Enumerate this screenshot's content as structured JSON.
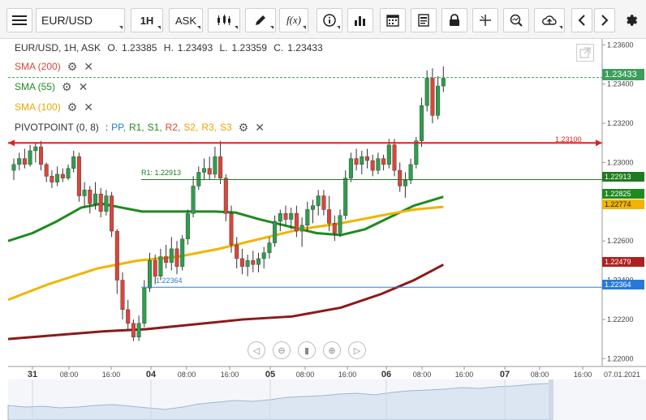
{
  "toolbar": {
    "symbol": "EUR/USD",
    "timeframe": "1H",
    "price_type": "ASK",
    "draw_icon": "pencil-icon",
    "function_label": "f(x)"
  },
  "legend": {
    "symbol": "EUR/USD, 1H, ASK",
    "open_label": "O.",
    "open": "1.23385",
    "high_label": "H.",
    "high": "1.23493",
    "low_label": "L.",
    "low": "1.23359",
    "close_label": "C.",
    "close": "1.23433",
    "sma200": "SMA (200)",
    "sma55": "SMA (55)",
    "sma100": "SMA (100)",
    "pivot": "PIVOTPOINT (0, 8)",
    "pivot_items": [
      "PP,",
      "R1,",
      "S1,",
      "R2,",
      "S2,",
      "R3,",
      "S3"
    ],
    "pivot_sep": ":"
  },
  "colors": {
    "sma200": "#8b1a1a",
    "sma55": "#1f8a1f",
    "sma100": "#f2b400",
    "up": "#2e9e4d",
    "down": "#d9463a",
    "pp": "#2a7ad5",
    "r1": "#1f8a1f",
    "s1": "#1f8a1f",
    "r2": "#d9463a",
    "s2": "#f2a000",
    "r3": "#f2a000",
    "s3": "#f2a000",
    "hline": "#e02020",
    "current": "#3a9e5a"
  },
  "price_axis": {
    "ticks": [
      "1.23600",
      "1.23400",
      "1.23200",
      "1.23000",
      "1.22600",
      "1.22400",
      "1.22200",
      "1.22000"
    ]
  },
  "price_labels": {
    "current": "1.23433",
    "hline": "1.23100",
    "r1": "1.22913",
    "sma55": "1.22825",
    "sma100": "1.22774",
    "sma200": "1.22479",
    "pp": "1.22364"
  },
  "chart_labels": {
    "r1": "R1: 1.22913",
    "pp": "1.22364",
    "hline": "1.23100"
  },
  "time_axis": {
    "ticks": [
      {
        "label": "31",
        "day": true
      },
      {
        "label": "08:00",
        "day": false
      },
      {
        "label": "16:00",
        "day": false
      },
      {
        "label": "04",
        "day": true
      },
      {
        "label": "08:00",
        "day": false
      },
      {
        "label": "16:00",
        "day": false
      },
      {
        "label": "05",
        "day": true
      },
      {
        "label": "08:00",
        "day": false
      },
      {
        "label": "16:00",
        "day": false
      },
      {
        "label": "06",
        "day": true
      },
      {
        "label": "08:00",
        "day": false
      },
      {
        "label": "16:00",
        "day": false
      },
      {
        "label": "07",
        "day": true
      },
      {
        "label": "08:00",
        "day": false
      },
      {
        "label": "16:00",
        "day": false
      }
    ],
    "end_date": "07.01.2021"
  },
  "candles": [
    [
      1.2296,
      1.2302,
      1.2291,
      1.2299
    ],
    [
      1.2299,
      1.2305,
      1.2296,
      1.2302
    ],
    [
      1.2302,
      1.2307,
      1.2297,
      1.2299
    ],
    [
      1.2299,
      1.2309,
      1.2298,
      1.2306
    ],
    [
      1.2306,
      1.231,
      1.23,
      1.2308
    ],
    [
      1.2308,
      1.2311,
      1.2296,
      1.2299
    ],
    [
      1.2299,
      1.23,
      1.229,
      1.2293
    ],
    [
      1.2293,
      1.2296,
      1.2287,
      1.229
    ],
    [
      1.229,
      1.2298,
      1.2288,
      1.2294
    ],
    [
      1.2294,
      1.2297,
      1.229,
      1.2292
    ],
    [
      1.2292,
      1.2299,
      1.2291,
      1.2297
    ],
    [
      1.2297,
      1.2306,
      1.2295,
      1.2303
    ],
    [
      1.2303,
      1.2305,
      1.228,
      1.2283
    ],
    [
      1.2283,
      1.229,
      1.2277,
      1.2286
    ],
    [
      1.2286,
      1.2288,
      1.2274,
      1.2279
    ],
    [
      1.2279,
      1.229,
      1.2276,
      1.2284
    ],
    [
      1.2284,
      1.2287,
      1.2272,
      1.2275
    ],
    [
      1.2275,
      1.2286,
      1.2273,
      1.2283
    ],
    [
      1.2283,
      1.2285,
      1.2262,
      1.2265
    ],
    [
      1.2265,
      1.2266,
      1.2233,
      1.224
    ],
    [
      1.224,
      1.2244,
      1.222,
      1.2225
    ],
    [
      1.2225,
      1.223,
      1.2215,
      1.2218
    ],
    [
      1.2218,
      1.222,
      1.2209,
      1.2211
    ],
    [
      1.2211,
      1.2222,
      1.2209,
      1.2218
    ],
    [
      1.2218,
      1.224,
      1.2216,
      1.2236
    ],
    [
      1.2236,
      1.2254,
      1.2234,
      1.225
    ],
    [
      1.225,
      1.2253,
      1.2238,
      1.2242
    ],
    [
      1.2242,
      1.2256,
      1.224,
      1.2252
    ],
    [
      1.2252,
      1.2258,
      1.2246,
      1.2249
    ],
    [
      1.2249,
      1.2262,
      1.2245,
      1.2256
    ],
    [
      1.2256,
      1.226,
      1.2243,
      1.2247
    ],
    [
      1.2247,
      1.2263,
      1.2245,
      1.2261
    ],
    [
      1.2261,
      1.2276,
      1.2258,
      1.2274
    ],
    [
      1.2274,
      1.2293,
      1.2272,
      1.2288
    ],
    [
      1.2288,
      1.2298,
      1.2286,
      1.2295
    ],
    [
      1.2295,
      1.2302,
      1.2291,
      1.2297
    ],
    [
      1.2297,
      1.2303,
      1.2291,
      1.2294
    ],
    [
      1.2294,
      1.2308,
      1.2292,
      1.2303
    ],
    [
      1.2303,
      1.2311,
      1.2289,
      1.2292
    ],
    [
      1.2292,
      1.2294,
      1.227,
      1.2274
    ],
    [
      1.2274,
      1.2278,
      1.2254,
      1.2258
    ],
    [
      1.2258,
      1.2262,
      1.2246,
      1.2251
    ],
    [
      1.2251,
      1.2256,
      1.2243,
      1.2247
    ],
    [
      1.2247,
      1.2253,
      1.2242,
      1.225
    ],
    [
      1.225,
      1.2255,
      1.2244,
      1.2248
    ],
    [
      1.2248,
      1.2254,
      1.2244,
      1.2251
    ],
    [
      1.2251,
      1.2257,
      1.2246,
      1.2254
    ],
    [
      1.2254,
      1.2262,
      1.2251,
      1.2259
    ],
    [
      1.2259,
      1.2273,
      1.2257,
      1.227
    ],
    [
      1.227,
      1.2276,
      1.2265,
      1.2274
    ],
    [
      1.2274,
      1.2278,
      1.2268,
      1.2271
    ],
    [
      1.2271,
      1.2277,
      1.2266,
      1.2274
    ],
    [
      1.2274,
      1.2278,
      1.2262,
      1.2265
    ],
    [
      1.2265,
      1.2272,
      1.2257,
      1.2268
    ],
    [
      1.2268,
      1.228,
      1.2265,
      1.2276
    ],
    [
      1.2276,
      1.2281,
      1.2269,
      1.2278
    ],
    [
      1.2278,
      1.2286,
      1.2273,
      1.2283
    ],
    [
      1.2283,
      1.2286,
      1.2273,
      1.2276
    ],
    [
      1.2276,
      1.2283,
      1.2265,
      1.2269
    ],
    [
      1.2269,
      1.2273,
      1.226,
      1.2264
    ],
    [
      1.2264,
      1.2276,
      1.2262,
      1.2273
    ],
    [
      1.2273,
      1.2296,
      1.2271,
      1.2292
    ],
    [
      1.2292,
      1.2305,
      1.229,
      1.2302
    ],
    [
      1.2302,
      1.2307,
      1.2296,
      1.2299
    ],
    [
      1.2299,
      1.2306,
      1.2294,
      1.2303
    ],
    [
      1.2303,
      1.2307,
      1.2297,
      1.2301
    ],
    [
      1.2301,
      1.2304,
      1.2293,
      1.2296
    ],
    [
      1.2296,
      1.2305,
      1.2294,
      1.2302
    ],
    [
      1.2302,
      1.2304,
      1.2296,
      1.2299
    ],
    [
      1.2299,
      1.2312,
      1.2297,
      1.2309
    ],
    [
      1.2309,
      1.2312,
      1.2293,
      1.2296
    ],
    [
      1.2296,
      1.23,
      1.2285,
      1.2288
    ],
    [
      1.2288,
      1.2295,
      1.2282,
      1.2291
    ],
    [
      1.2291,
      1.2302,
      1.2289,
      1.2299
    ],
    [
      1.2299,
      1.2313,
      1.2297,
      1.2311
    ],
    [
      1.2311,
      1.2333,
      1.2308,
      1.2329
    ],
    [
      1.2329,
      1.2347,
      1.2326,
      1.2343
    ],
    [
      1.2343,
      1.2348,
      1.232,
      1.2324
    ],
    [
      1.2324,
      1.2344,
      1.2322,
      1.2339
    ],
    [
      1.2339,
      1.2349,
      1.2336,
      1.2343
    ]
  ],
  "overview_range": "07.01.2021"
}
